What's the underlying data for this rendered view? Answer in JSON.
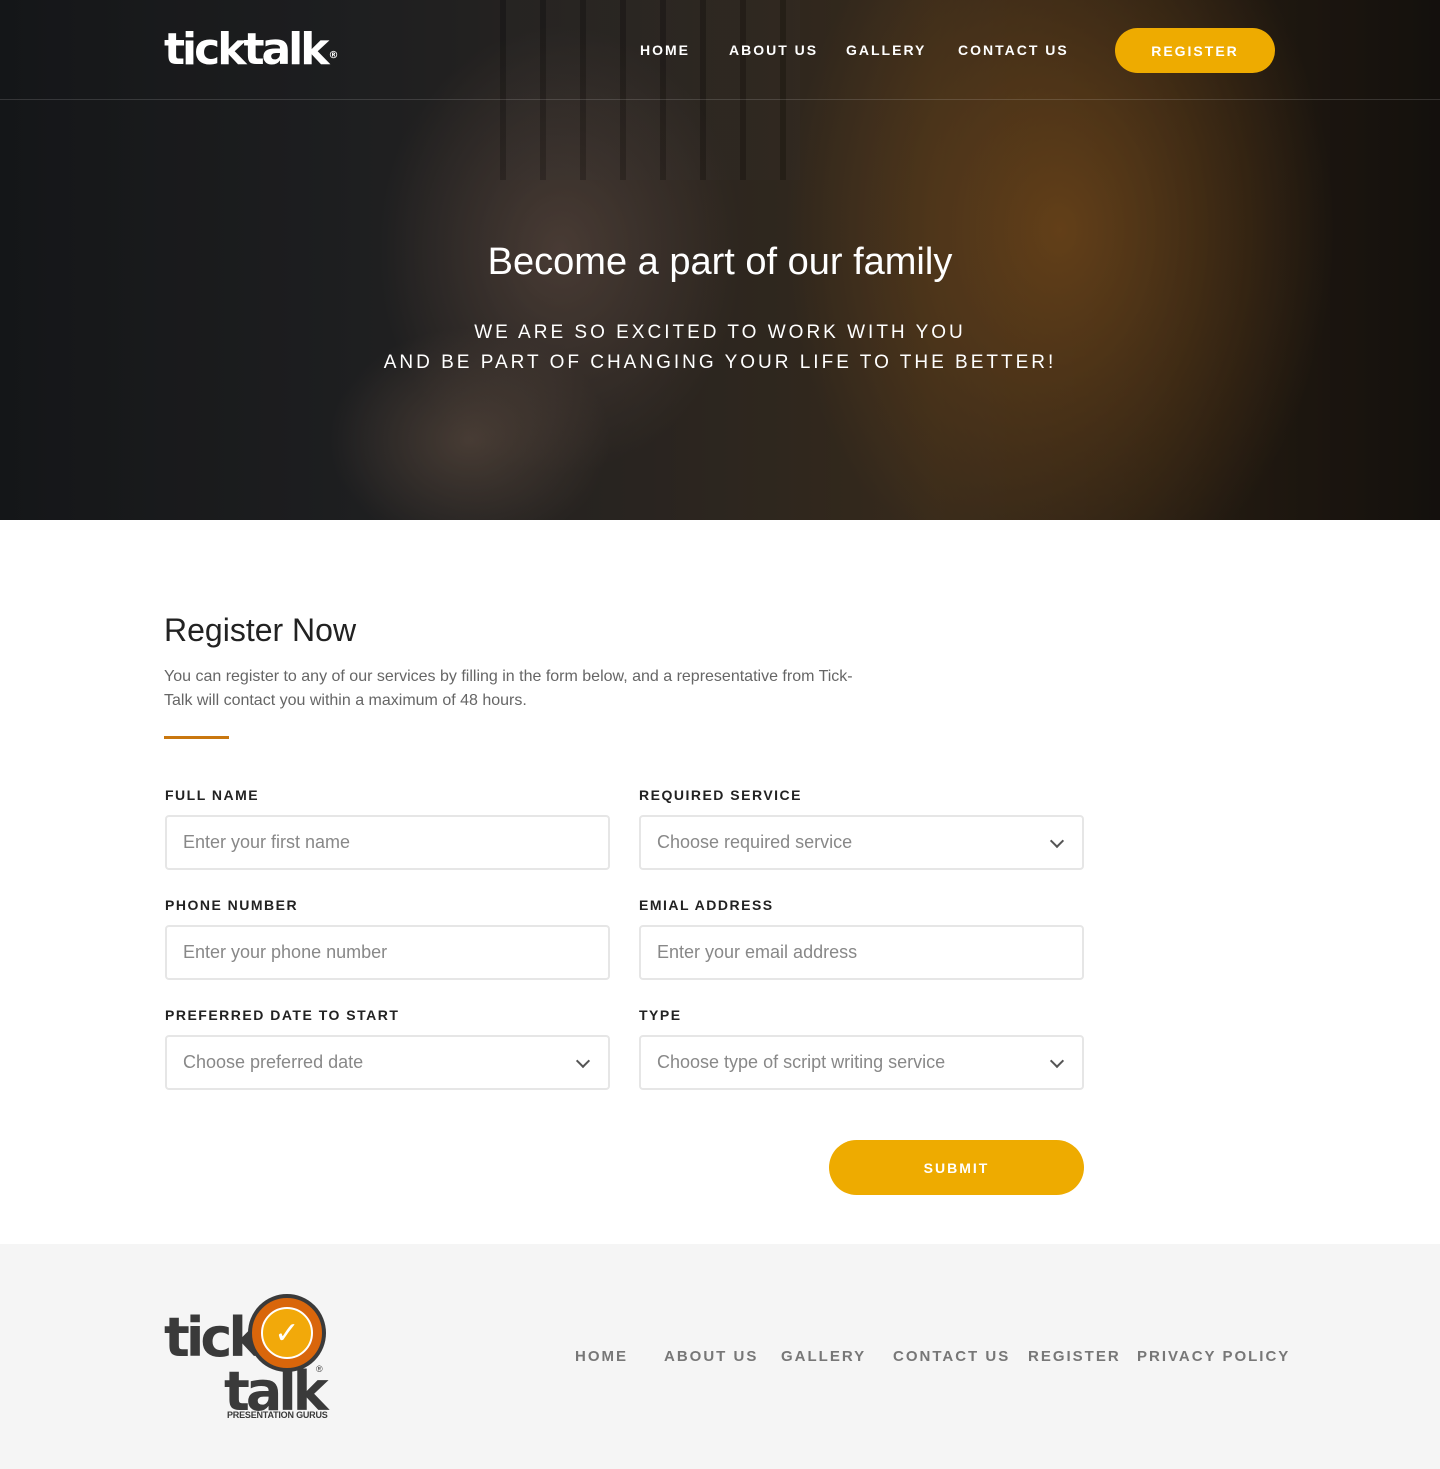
{
  "header": {
    "logo_text": "ticktalk",
    "logo_reg": "®",
    "nav": [
      "HOME",
      "ABOUT US",
      "GALLERY",
      "CONTACT US"
    ],
    "register_label": "REGISTER"
  },
  "hero": {
    "title": "Become a part of our family",
    "subtitle_line1": "WE ARE SO EXCITED TO WORK WITH YOU",
    "subtitle_line2": "AND BE PART OF CHANGING YOUR LIFE TO THE BETTER!"
  },
  "form": {
    "title": "Register Now",
    "description": "You can register to any of our services by filling in the form below, and a representative from Tick-Talk will contact you within a maximum of 48 hours.",
    "fields": {
      "full_name": {
        "label": "FULL NAME",
        "placeholder": "Enter your first name"
      },
      "required_service": {
        "label": "REQUIRED SERVICE",
        "placeholder": "Choose required service"
      },
      "phone": {
        "label": "PHONE NUMBER",
        "placeholder": "Enter your phone number"
      },
      "email": {
        "label": "EMIAL ADDRESS",
        "placeholder": "Enter your email address"
      },
      "date": {
        "label": "PREFERRED DATE TO START",
        "placeholder": "Choose preferred date"
      },
      "type": {
        "label": "TYPE",
        "placeholder": "Choose type of script writing service"
      }
    },
    "submit_label": "SUBMIT"
  },
  "footer": {
    "logo_tick": "tick",
    "logo_talk": "talk",
    "logo_reg": "®",
    "logo_tagline": "PRESENTATION GURUS",
    "links": [
      "HOME",
      "ABOUT US",
      "GALLERY",
      "CONTACT US",
      "REGISTER",
      "PRIVACY POLICY"
    ]
  },
  "colors": {
    "accent": "#eeab00",
    "underline": "#c9770f",
    "footer_bg": "#f5f5f5"
  }
}
